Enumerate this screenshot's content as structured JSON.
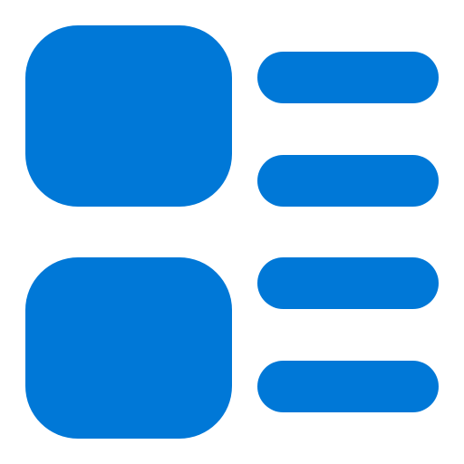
{
  "icon": {
    "name": "list-view-icon",
    "color": "#0078D7",
    "background": "#FFFFFF",
    "groups": [
      {
        "thumbnail": "thumbnail-block",
        "lines": [
          "line-1",
          "line-2"
        ]
      },
      {
        "thumbnail": "thumbnail-block",
        "lines": [
          "line-3",
          "line-4"
        ]
      }
    ]
  }
}
